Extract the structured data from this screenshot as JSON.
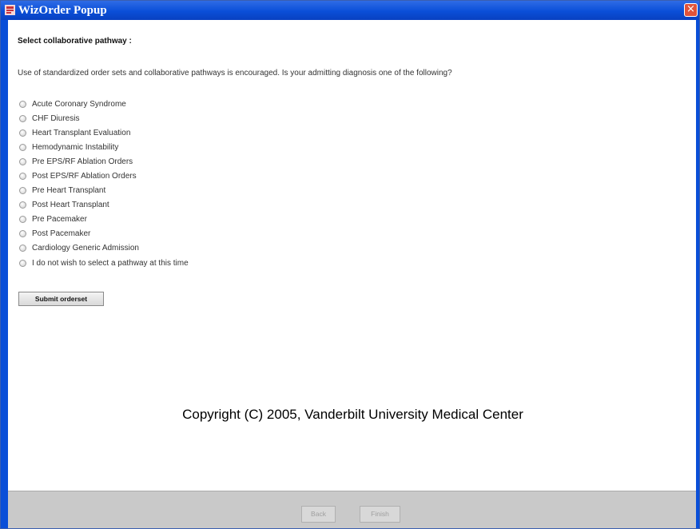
{
  "window": {
    "title": "WizOrder Popup",
    "close_label": "×"
  },
  "main": {
    "heading": "Select collaborative pathway :",
    "intro": "Use of standardized order sets and collaborative pathways is encouraged. Is your admitting diagnosis one of the following?",
    "options": [
      {
        "label": "Acute Coronary Syndrome"
      },
      {
        "label": "CHF Diuresis"
      },
      {
        "label": "Heart Transplant Evaluation"
      },
      {
        "label": "Hemodynamic Instability"
      },
      {
        "label": "Pre EPS/RF Ablation Orders"
      },
      {
        "label": "Post EPS/RF Ablation Orders"
      },
      {
        "label": "Pre Heart Transplant"
      },
      {
        "label": "Post Heart Transplant"
      },
      {
        "label": "Pre Pacemaker"
      },
      {
        "label": "Post Pacemaker"
      },
      {
        "label": "Cardiology Generic Admission"
      },
      {
        "label": "I do not wish to select a pathway at this time"
      }
    ],
    "submit_label": "Submit orderset",
    "copyright": "Copyright (C) 2005, Vanderbilt University Medical Center"
  },
  "footer": {
    "back_label": "Back",
    "finish_label": "Finish"
  },
  "colors": {
    "titlebar": "#0a4fd8",
    "close": "#e0533a",
    "footer": "#c9c9c9"
  }
}
